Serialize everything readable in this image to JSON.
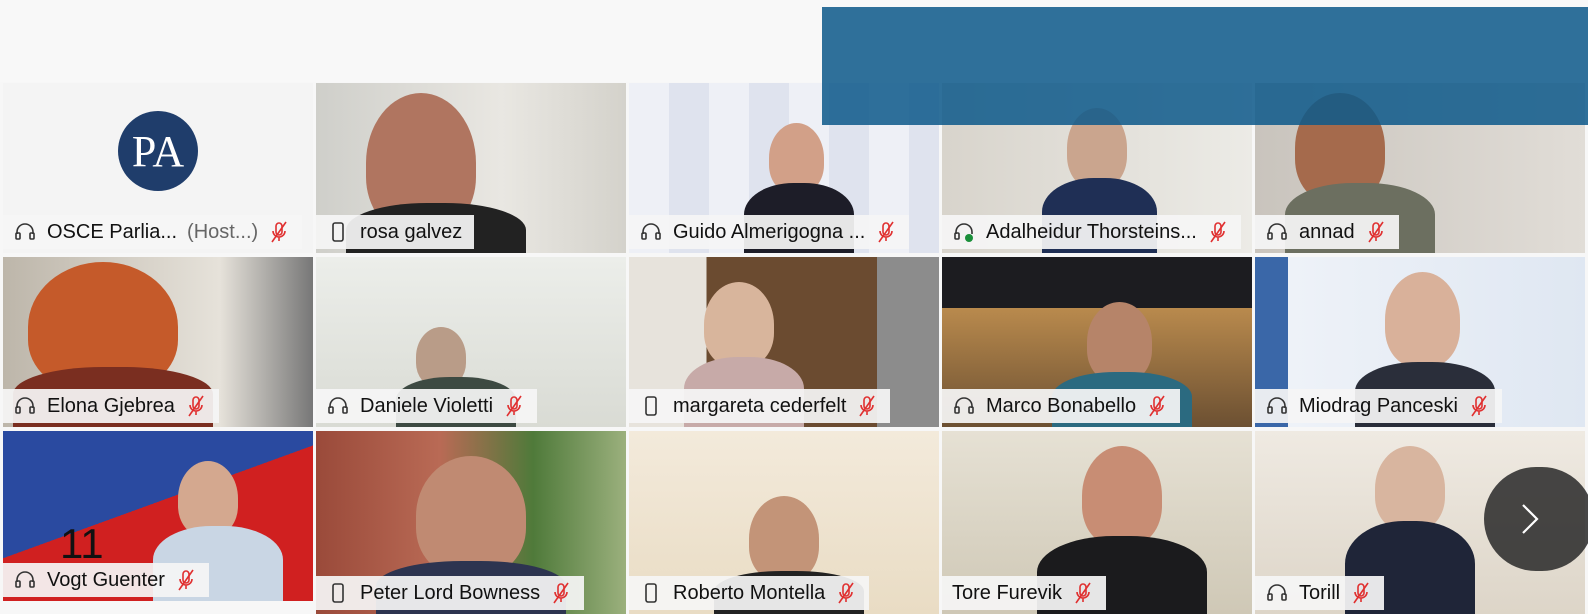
{
  "meeting": {
    "page_number": "11",
    "accent_color": "#00a3e0",
    "banner_color": "#0e5a8a",
    "mute_color": "#e03030"
  },
  "participants": [
    {
      "name": "OSCE Parlia...",
      "suffix": "(Host...)",
      "device": "headset-icon",
      "muted": true,
      "logo_text": "PA"
    },
    {
      "name": "rosa galvez",
      "device": "phone-icon",
      "muted": false,
      "speaking": true
    },
    {
      "name": "Guido Almerigogna ...",
      "device": "headset-icon",
      "muted": true
    },
    {
      "name": "Adalheidur Thorsteins...",
      "device": "headset-status-icon",
      "muted": true
    },
    {
      "name": "annad",
      "device": "headset-icon",
      "muted": true
    },
    {
      "name": "Elona Gjebrea",
      "device": "headset-icon",
      "muted": true
    },
    {
      "name": "Daniele Violetti",
      "device": "headset-icon",
      "muted": true
    },
    {
      "name": "margareta cederfelt",
      "device": "phone-icon",
      "muted": true
    },
    {
      "name": "Marco Bonabello",
      "device": "headset-icon",
      "muted": true
    },
    {
      "name": "Miodrag Panceski",
      "device": "headset-icon",
      "muted": true
    },
    {
      "name": "Vogt Guenter",
      "device": "headset-icon",
      "muted": true
    },
    {
      "name": "Peter Lord Bowness",
      "device": "phone-icon",
      "muted": true
    },
    {
      "name": "Roberto Montella",
      "device": "phone-icon",
      "muted": true
    },
    {
      "name": "Tore Furevik",
      "device": "none",
      "muted": true
    },
    {
      "name": "Torill",
      "device": "headset-icon",
      "muted": true
    }
  ]
}
